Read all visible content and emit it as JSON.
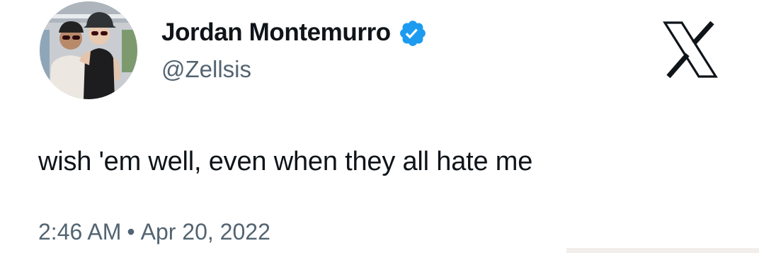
{
  "user": {
    "display_name": "Jordan Montemurro",
    "handle": "@Zellsis",
    "verified": true,
    "verified_color": "#1d9bf0",
    "avatar_icon": "profile-photo-two-people"
  },
  "brand": {
    "logo_icon": "x-logo"
  },
  "tweet": {
    "text": "wish 'em well, even when they all hate me",
    "time": "2:46 AM",
    "separator": "•",
    "date": "Apr 20, 2022"
  }
}
